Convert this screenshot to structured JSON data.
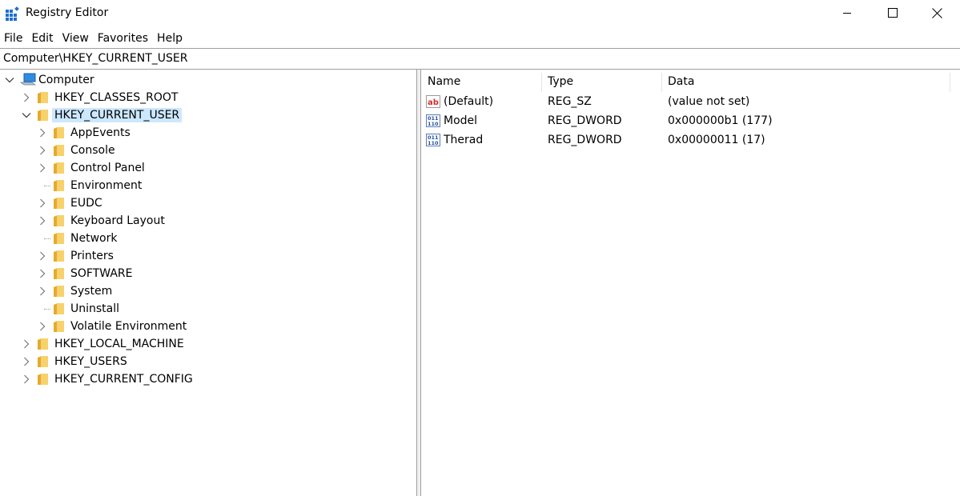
{
  "window": {
    "title": "Registry Editor"
  },
  "menu": {
    "items": [
      "File",
      "Edit",
      "View",
      "Favorites",
      "Help"
    ]
  },
  "address": {
    "path": "Computer\\HKEY_CURRENT_USER"
  },
  "tree": {
    "root": "Computer",
    "hives": {
      "classes_root": "HKEY_CLASSES_ROOT",
      "current_user": "HKEY_CURRENT_USER",
      "local_machine": "HKEY_LOCAL_MACHINE",
      "users": "HKEY_USERS",
      "current_config": "HKEY_CURRENT_CONFIG"
    },
    "current_user_children": [
      "AppEvents",
      "Console",
      "Control Panel",
      "Environment",
      "EUDC",
      "Keyboard Layout",
      "Network",
      "Printers",
      "SOFTWARE",
      "System",
      "Uninstall",
      "Volatile Environment"
    ]
  },
  "list": {
    "columns": {
      "name": "Name",
      "type": "Type",
      "data": "Data"
    },
    "rows": [
      {
        "name": "(Default)",
        "type": "REG_SZ",
        "data": "(value not set)",
        "icon": "string-value-icon"
      },
      {
        "name": "Model",
        "type": "REG_DWORD",
        "data": "0x000000b1 (177)",
        "icon": "binary-value-icon"
      },
      {
        "name": "Therad",
        "type": "REG_DWORD",
        "data": "0x00000011 (17)",
        "icon": "binary-value-icon"
      }
    ]
  },
  "colors": {
    "selection": "#cce8ff",
    "folder": "#f3c44b",
    "accent": "#1f6fcf"
  }
}
